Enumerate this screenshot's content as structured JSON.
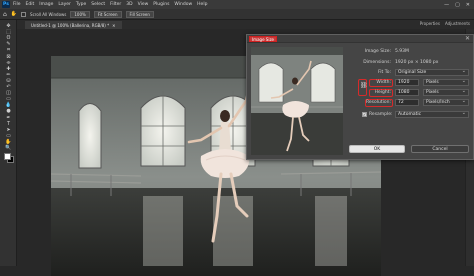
{
  "menubar": {
    "app_icon": "Ps",
    "items": [
      "File",
      "Edit",
      "Image",
      "Layer",
      "Type",
      "Select",
      "Filter",
      "3D",
      "View",
      "Plugins",
      "Window",
      "Help"
    ],
    "window_controls": [
      "—",
      "▢",
      "✕"
    ]
  },
  "options_bar": {
    "scroll_all_windows": "Scroll All Windows",
    "zoom": "100%",
    "fit_screen": "Fit Screen",
    "fill_screen": "Fill Screen"
  },
  "document_tab": {
    "title": "Untitled-1 @ 100% (Ballerina, RGB/8) *",
    "close": "✕"
  },
  "panel_tabs": [
    "Properties",
    "Adjustments"
  ],
  "tools": [
    "move-icon",
    "marquee-icon",
    "lasso-icon",
    "quick-select-icon",
    "crop-icon",
    "frame-icon",
    "eyedropper-icon",
    "healing-icon",
    "brush-icon",
    "stamp-icon",
    "history-brush-icon",
    "eraser-icon",
    "gradient-icon",
    "blur-icon",
    "dodge-icon",
    "pen-icon",
    "type-icon",
    "path-select-icon",
    "shape-icon",
    "hand-icon",
    "zoom-icon"
  ],
  "tool_glyphs": [
    "✥",
    "⬚",
    "ʘ",
    "✎",
    "⌗",
    "⊠",
    "⌯",
    "✚",
    "✏",
    "⛁",
    "↶",
    "◫",
    "▭",
    "💧",
    "●",
    "✒",
    "T",
    "➤",
    "▭",
    "✋",
    "🔍"
  ],
  "dialog": {
    "title": "Image Size",
    "close": "✕",
    "image_size_label": "Image Size:",
    "image_size_value": "5.93M",
    "dimensions_label": "Dimensions:",
    "dimensions_value": "1920 px × 1080 px",
    "fit_to_label": "Fit To:",
    "fit_to_value": "Original Size",
    "width_label": "Width:",
    "width_value": "1920",
    "width_unit": "Pixels",
    "height_label": "Height:",
    "height_value": "1080",
    "height_unit": "Pixels",
    "resolution_label": "Resolution:",
    "resolution_value": "72",
    "resolution_unit": "Pixels/Inch",
    "resample_label": "Resample:",
    "resample_value": "Automatic",
    "ok": "OK",
    "cancel": "Cancel"
  },
  "colors": {
    "highlight": "#d62a2a",
    "accent": "#31a8ff"
  }
}
